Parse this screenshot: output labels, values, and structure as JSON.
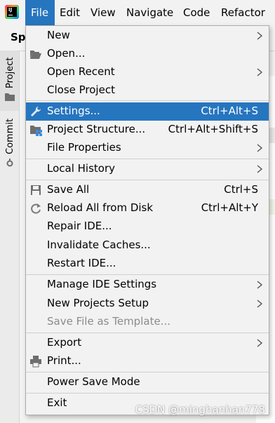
{
  "menubar": {
    "items": [
      {
        "label": "File"
      },
      {
        "label": "Edit"
      },
      {
        "label": "View"
      },
      {
        "label": "Navigate"
      },
      {
        "label": "Code"
      },
      {
        "label": "Refactor"
      }
    ]
  },
  "toolbar": {
    "project_prefix": "Spr"
  },
  "tool_stripe": {
    "project_label": "Project",
    "commit_label": "Commit"
  },
  "file_menu": {
    "items": [
      {
        "label": "New",
        "submenu": true
      },
      {
        "label": "Open...",
        "submenu": false
      },
      {
        "label": "Open Recent",
        "submenu": true
      },
      {
        "label": "Close Project",
        "submenu": false
      },
      {
        "label": "Settings...",
        "shortcut": "Ctrl+Alt+S",
        "highlighted": true
      },
      {
        "label": "Project Structure...",
        "shortcut": "Ctrl+Alt+Shift+S"
      },
      {
        "label": "File Properties",
        "submenu": true
      },
      {
        "label": "Local History",
        "submenu": true
      },
      {
        "label": "Save All",
        "shortcut": "Ctrl+S"
      },
      {
        "label": "Reload All from Disk",
        "shortcut": "Ctrl+Alt+Y"
      },
      {
        "label": "Repair IDE..."
      },
      {
        "label": "Invalidate Caches..."
      },
      {
        "label": "Restart IDE..."
      },
      {
        "label": "Manage IDE Settings",
        "submenu": true
      },
      {
        "label": "New Projects Setup",
        "submenu": true
      },
      {
        "label": "Save File as Template...",
        "disabled": true
      },
      {
        "label": "Export",
        "submenu": true
      },
      {
        "label": "Print..."
      },
      {
        "label": "Power Save Mode"
      },
      {
        "label": "Exit"
      }
    ]
  },
  "watermark": "CSDN @minghanhan778",
  "colors": {
    "highlight": "#2675bf",
    "menu_bg": "#f2f2f2",
    "disabled_text": "#8c8c8c"
  }
}
